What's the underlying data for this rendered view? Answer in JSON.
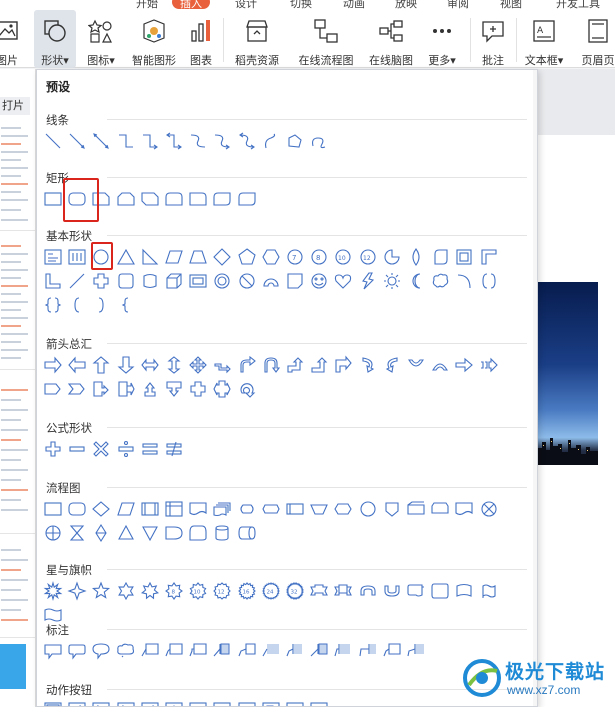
{
  "menu": {
    "tabs": [
      {
        "label": "开始",
        "active": false
      },
      {
        "label": "插入",
        "active": true
      },
      {
        "label": "设计",
        "active": false
      },
      {
        "label": "切换",
        "active": false
      },
      {
        "label": "动画",
        "active": false
      },
      {
        "label": "放映",
        "active": false
      },
      {
        "label": "审阅",
        "active": false
      },
      {
        "label": "视图",
        "active": false
      },
      {
        "label": "开发工具",
        "active": false
      }
    ]
  },
  "ribbon": {
    "picture": "图片",
    "shapes": "形状",
    "icons": "图标",
    "smart_art": "智能图形",
    "chart": "图表",
    "docer": "稻壳资源",
    "online_flow": "在线流程图",
    "online_mind": "在线脑图",
    "more": "更多",
    "comment": "批注",
    "textbox": "文本框",
    "header_footer": "页眉页"
  },
  "left_panel": {
    "tab_label": "打片"
  },
  "dropdown": {
    "title": "预设",
    "categories": [
      {
        "label": "线条",
        "count": 12,
        "type": "line"
      },
      {
        "label": "矩形",
        "count": 9,
        "type": "rect"
      },
      {
        "label": "基本形状",
        "count": 42,
        "type": "basic"
      },
      {
        "label": "箭头总汇",
        "count": 28,
        "type": "arrow"
      },
      {
        "label": "公式形状",
        "count": 6,
        "type": "formula"
      },
      {
        "label": "流程图",
        "count": 28,
        "type": "flow"
      },
      {
        "label": "星与旗帜",
        "count": 20,
        "type": "star"
      },
      {
        "label": "标注",
        "count": 16,
        "type": "callout"
      },
      {
        "label": "动作按钮",
        "count": 12,
        "type": "action"
      }
    ]
  },
  "watermark": {
    "main": "极光下载站",
    "sub": "www.xz7.com"
  },
  "colors": {
    "shape_stroke": "#4472c4",
    "highlight": "#d9251c",
    "active_tab": "#e8603c",
    "watermark": "#1f8ad6"
  }
}
